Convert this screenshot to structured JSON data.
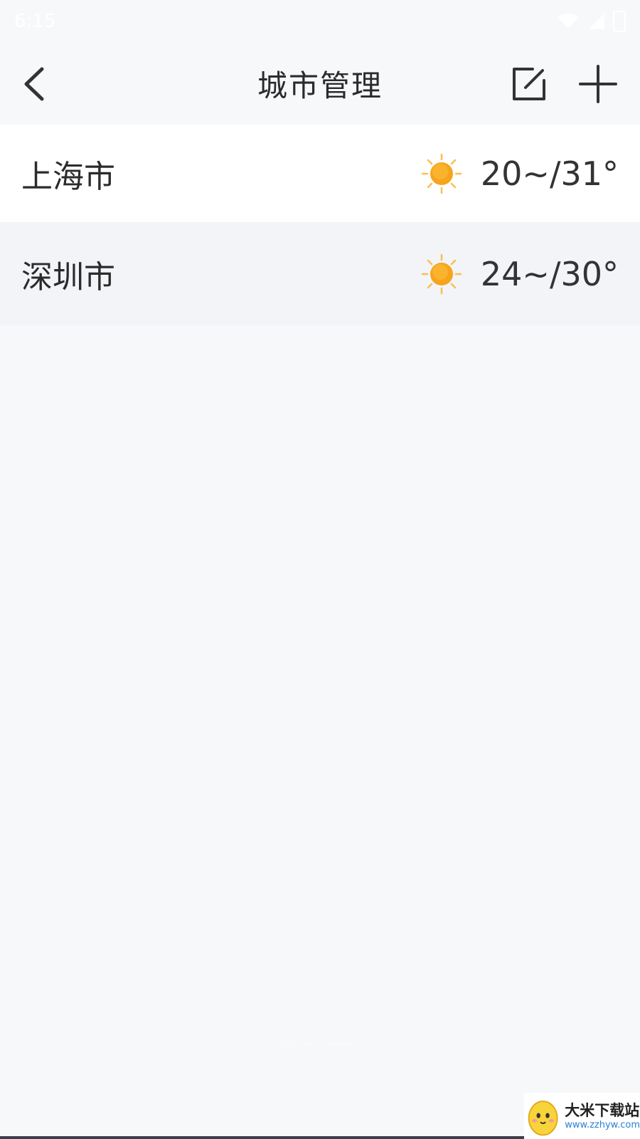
{
  "status_bar": {
    "time": "6:15"
  },
  "nav": {
    "title": "城市管理"
  },
  "cities": [
    {
      "name": "上海市",
      "weather_icon": "sun-icon",
      "temp_range": "20~/31°"
    },
    {
      "name": "深圳市",
      "weather_icon": "sun-icon",
      "temp_range": "24~/30°"
    }
  ],
  "watermark": {
    "title": "大米下载站",
    "url": "www.zzhyw.com"
  },
  "colors": {
    "background": "#f7f8fa",
    "row_alt": "#f2f4f8",
    "sun": "#f7a41d",
    "text": "#2b2b2b"
  }
}
